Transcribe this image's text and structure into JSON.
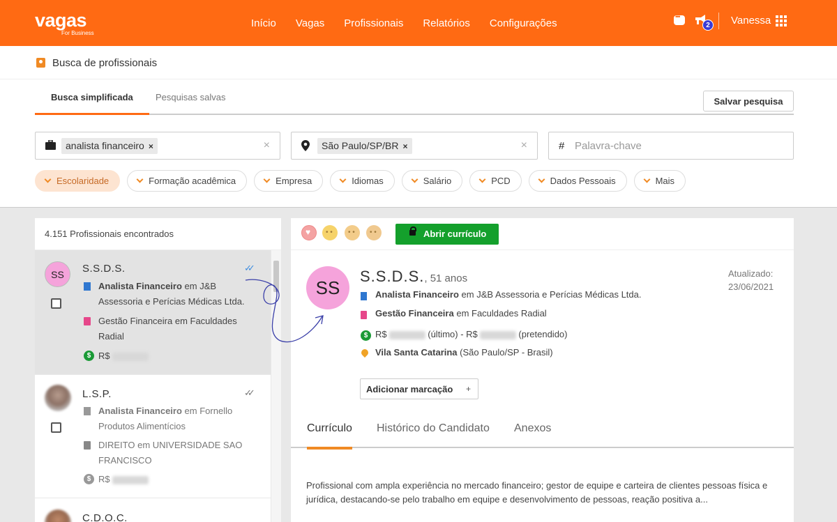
{
  "app": {
    "logo": "vagas",
    "logo_sub": "For Business",
    "nav": [
      "Início",
      "Vagas",
      "Profissionais",
      "Relatórios",
      "Configurações"
    ],
    "notification_count": "2",
    "user": "Vanessa"
  },
  "page": {
    "title": "Busca de profissionais",
    "tabs": [
      "Busca simplificada",
      "Pesquisas salvas"
    ],
    "save_search": "Salvar pesquisa"
  },
  "search": {
    "role_chip": "analista financeiro",
    "location_chip": "São Paulo/SP/BR",
    "keyword_placeholder": "Palavra-chave",
    "keyword_icon": "#",
    "clear_symbol": "×",
    "chip_remove": "×"
  },
  "filters": [
    "Escolaridade",
    "Formação acadêmica",
    "Empresa",
    "Idiomas",
    "Salário",
    "PCD",
    "Dados Pessoais",
    "Mais"
  ],
  "results": {
    "count_label": "4.151 Profissionais encontrados",
    "candidates": [
      {
        "initials": "SS",
        "name": "S.S.D.S.",
        "job_title": "Analista Financeiro",
        "job_connector": "em",
        "job_company": "J&B Assessoria e Perícias Médicas Ltda.",
        "education": "Gestão Financeira em Faculdades Radial",
        "salary_prefix": "R$",
        "status_icon": "double-check-blue"
      },
      {
        "name": "L.S.P.",
        "job_title": "Analista Financeiro",
        "job_connector": "em",
        "job_company": "Fornello Produtos Alimentícios",
        "education": "DIREITO em UNIVERSIDADE SAO FRANCISCO",
        "salary_prefix": "R$",
        "status_icon": "double-check-grey"
      },
      {
        "name": "C.D.O.C."
      }
    ]
  },
  "detail": {
    "open_resume": "Abrir currículo",
    "initials": "SS",
    "name": "S.S.D.S.",
    "age": ", 51 anos",
    "updated_label": "Atualizado:",
    "updated_date": "23/06/2021",
    "job_title": "Analista Financeiro",
    "job_rest": "em J&B Assessoria e Perícias Médicas Ltda.",
    "education_title": "Gestão Financeira",
    "education_rest": "em Faculdades Radial",
    "salary_prefix": "R$",
    "salary_last": "(último) - R$",
    "salary_wanted": "(pretendido)",
    "location_name": "Vila Santa Catarina",
    "location_rest": "(São Paulo/SP - Brasil)",
    "add_tag": "Adicionar marcação",
    "add_tag_symbol": "+",
    "tabs": [
      "Currículo",
      "Histórico do Candidato",
      "Anexos"
    ],
    "summary": "Profissional com ampla experiência no mercado financeiro; gestor de equipe e carteira de clientes pessoas física e jurídica, destacando-se pelo trabalho em equipe e desenvolvimento de pessoas, reação positiva a..."
  },
  "colors": {
    "brand": "#ff6a13",
    "open_button": "#14a02c",
    "avatar": "#f5a3db",
    "accent_blue": "#3f8de0"
  }
}
